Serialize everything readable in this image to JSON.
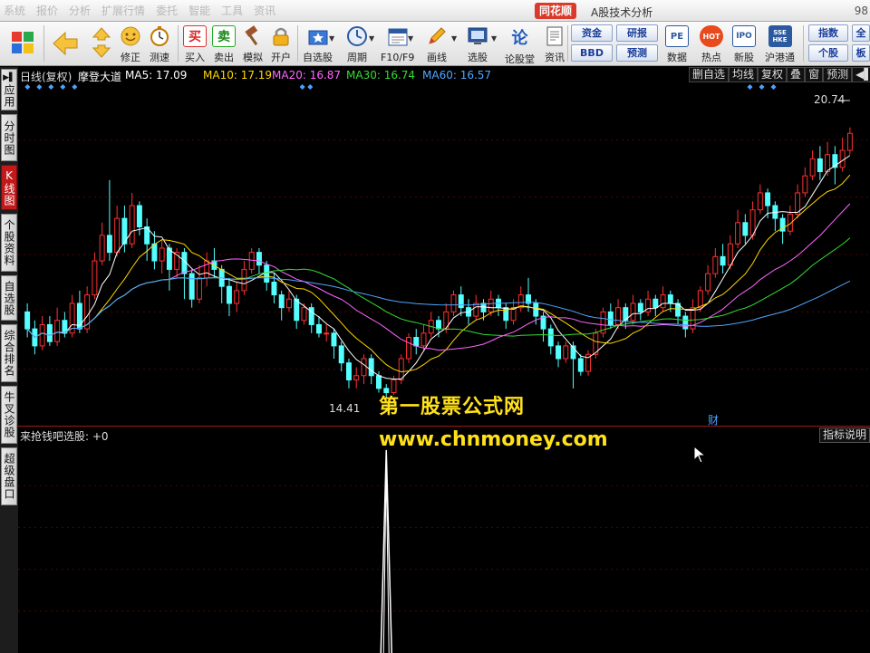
{
  "menu": {
    "items": [
      "系统",
      "报价",
      "分析",
      "扩展行情",
      "委托",
      "智能",
      "工具",
      "资讯"
    ],
    "brand": "同花顺",
    "window_title": "A股技术分析",
    "corner_text": "98"
  },
  "toolbar": {
    "buttons": [
      {
        "id": "repair",
        "label": "修正",
        "icon": "smile-icon"
      },
      {
        "id": "speed",
        "label": "测速",
        "icon": "stopwatch-icon"
      },
      {
        "id": "buy",
        "label": "买入",
        "icon": "buy-icon",
        "glyph": "买"
      },
      {
        "id": "sell",
        "label": "卖出",
        "icon": "sell-icon",
        "glyph": "卖"
      },
      {
        "id": "simulate",
        "label": "模拟",
        "icon": "hammer-icon"
      },
      {
        "id": "open-account",
        "label": "开户",
        "icon": "lock-icon"
      },
      {
        "id": "watchlist",
        "label": "自选股",
        "icon": "star-folder-icon"
      },
      {
        "id": "period",
        "label": "周期",
        "icon": "clock-icon"
      },
      {
        "id": "f10",
        "label": "F10/F9",
        "icon": "f10-icon"
      },
      {
        "id": "draw",
        "label": "画线",
        "icon": "pencil-icon"
      },
      {
        "id": "pick-stock",
        "label": "选股",
        "icon": "screen-icon"
      },
      {
        "id": "forum",
        "label": "论股堂",
        "icon": "forum-icon",
        "glyph": "论"
      },
      {
        "id": "news",
        "label": "资讯",
        "icon": "document-icon"
      },
      {
        "id": "data",
        "label": "数据",
        "icon": "pe-icon",
        "glyph": "PE"
      },
      {
        "id": "hot",
        "label": "热点",
        "icon": "hot-icon",
        "glyph": "HOT"
      },
      {
        "id": "new-stock",
        "label": "新股",
        "icon": "ipo-icon",
        "glyph": "IPO"
      },
      {
        "id": "hk-connect",
        "label": "沪港通",
        "icon": "sse-hke-icon",
        "glyph": "SSE HKE"
      }
    ],
    "small_buttons": {
      "fund": "资金",
      "research": "研报",
      "bbd": "BBD",
      "forecast": "预测",
      "index": "指数",
      "individual": "个股",
      "full": "全",
      "board": "板"
    }
  },
  "left_tabs": [
    {
      "label": "应用",
      "active": false,
      "icon": "play-icon"
    },
    {
      "label": "分时图",
      "active": false
    },
    {
      "label": "K线图",
      "active": true
    },
    {
      "label": "个股资料",
      "active": false
    },
    {
      "label": "自选股",
      "active": false
    },
    {
      "label": "综合排名",
      "active": false
    },
    {
      "label": "牛叉诊股",
      "active": false
    },
    {
      "label": "超级盘口",
      "active": false
    }
  ],
  "chart_header": {
    "period": "日线(复权)",
    "stock_name": "摩登大道",
    "ma5": "MA5: 17.09",
    "ma10": "MA10: 17.19",
    "ma20": "MA20: 16.87",
    "ma30": "MA30: 16.74",
    "ma60": "MA60: 16.57",
    "colors": {
      "ma5": "#ffffff",
      "ma10": "#ffd700",
      "ma20": "#ff66ff",
      "ma30": "#33dd33",
      "ma60": "#4fa6ff"
    }
  },
  "right_buttons": [
    "删自选",
    "均线",
    "复权",
    "叠",
    "窗",
    "预测"
  ],
  "price_labels": {
    "high": "20.74",
    "low": "14.41",
    "cai": "财"
  },
  "watermark": {
    "line1": "第一股票公式网",
    "line2": "www.chnmoney.com"
  },
  "indicator": {
    "header": "来抢钱吧选股: +0",
    "help_button": "指标说明"
  },
  "colors": {
    "up": "#ff3030",
    "down": "#54ffff",
    "grid": "#5a0000",
    "accent": "#c21a1a"
  },
  "chart_data": {
    "type": "candlestick",
    "series_name": "摩登大道 日线(复权)",
    "ylim": [
      14.0,
      21.5
    ],
    "high": 20.74,
    "low": 14.41,
    "candles": [
      [
        16.4,
        16.0,
        16.6,
        15.8
      ],
      [
        16.0,
        15.6,
        16.2,
        15.4
      ],
      [
        15.6,
        16.1,
        16.3,
        15.5
      ],
      [
        16.1,
        15.7,
        16.3,
        15.6
      ],
      [
        15.7,
        16.2,
        16.5,
        15.6
      ],
      [
        16.2,
        15.9,
        16.4,
        15.8
      ],
      [
        15.9,
        16.6,
        16.8,
        15.8
      ],
      [
        16.6,
        16.0,
        16.9,
        15.9
      ],
      [
        16.0,
        16.8,
        17.0,
        15.9
      ],
      [
        16.8,
        17.6,
        17.8,
        16.7
      ],
      [
        17.6,
        18.2,
        18.5,
        17.5
      ],
      [
        18.2,
        17.8,
        19.5,
        17.6
      ],
      [
        17.8,
        18.6,
        18.9,
        17.7
      ],
      [
        18.6,
        18.0,
        18.9,
        17.8
      ],
      [
        18.0,
        18.9,
        19.2,
        17.9
      ],
      [
        18.9,
        18.4,
        19.0,
        18.2
      ],
      [
        18.4,
        18.0,
        18.6,
        17.6
      ],
      [
        18.0,
        17.6,
        18.3,
        17.4
      ],
      [
        17.6,
        17.9,
        18.1,
        17.3
      ],
      [
        17.9,
        17.4,
        18.0,
        16.9
      ],
      [
        17.4,
        17.8,
        17.9,
        17.2
      ],
      [
        17.8,
        17.3,
        17.9,
        16.7
      ],
      [
        17.3,
        16.7,
        17.4,
        16.5
      ],
      [
        16.7,
        17.2,
        17.5,
        16.6
      ],
      [
        17.2,
        17.6,
        17.8,
        17.0
      ],
      [
        17.6,
        17.4,
        17.9,
        17.2
      ],
      [
        17.4,
        17.0,
        17.5,
        16.6
      ],
      [
        17.0,
        16.6,
        17.2,
        16.3
      ],
      [
        16.6,
        16.9,
        17.1,
        16.4
      ],
      [
        16.9,
        17.4,
        17.6,
        16.8
      ],
      [
        17.4,
        17.8,
        17.9,
        17.3
      ],
      [
        17.8,
        17.5,
        17.9,
        17.3
      ],
      [
        17.5,
        17.1,
        17.6,
        16.9
      ],
      [
        17.1,
        16.8,
        17.3,
        16.6
      ],
      [
        16.8,
        16.5,
        16.9,
        16.2
      ],
      [
        16.5,
        16.7,
        16.9,
        16.4
      ],
      [
        16.7,
        16.2,
        16.8,
        16.0
      ],
      [
        16.2,
        16.5,
        16.6,
        16.1
      ],
      [
        16.5,
        16.1,
        16.6,
        15.9
      ],
      [
        16.1,
        15.9,
        16.3,
        15.8
      ],
      [
        15.9,
        15.9,
        16.1,
        15.7
      ],
      [
        15.9,
        15.6,
        16.0,
        15.3
      ],
      [
        15.6,
        15.2,
        15.7,
        15.0
      ],
      [
        15.2,
        14.8,
        15.3,
        14.6
      ],
      [
        14.8,
        14.9,
        15.1,
        14.6
      ],
      [
        14.9,
        15.3,
        15.4,
        14.7
      ],
      [
        15.3,
        14.9,
        15.4,
        14.7
      ],
      [
        14.9,
        14.6,
        15.0,
        14.5
      ],
      [
        14.6,
        14.5,
        14.7,
        14.41
      ],
      [
        14.5,
        14.8,
        14.9,
        14.45
      ],
      [
        14.8,
        15.3,
        15.4,
        14.7
      ],
      [
        15.3,
        15.8,
        15.9,
        15.2
      ],
      [
        15.8,
        15.6,
        16.0,
        15.4
      ],
      [
        15.6,
        15.9,
        16.1,
        15.5
      ],
      [
        15.9,
        16.2,
        16.4,
        15.8
      ],
      [
        16.2,
        16.0,
        16.3,
        15.8
      ],
      [
        16.0,
        16.4,
        16.6,
        15.9
      ],
      [
        16.4,
        16.8,
        16.9,
        16.3
      ],
      [
        16.8,
        16.5,
        17.0,
        16.3
      ],
      [
        16.5,
        16.3,
        16.7,
        16.1
      ],
      [
        16.3,
        16.6,
        16.8,
        16.2
      ],
      [
        16.6,
        16.4,
        16.7,
        16.2
      ],
      [
        16.4,
        16.7,
        16.9,
        16.3
      ],
      [
        16.7,
        16.5,
        16.8,
        16.3
      ],
      [
        16.5,
        16.2,
        16.6,
        16.0
      ],
      [
        16.2,
        16.5,
        16.7,
        16.1
      ],
      [
        16.5,
        16.8,
        17.0,
        16.4
      ],
      [
        16.8,
        16.6,
        17.2,
        16.4
      ],
      [
        16.6,
        16.3,
        16.7,
        16.1
      ],
      [
        16.3,
        16.0,
        16.4,
        15.7
      ],
      [
        16.0,
        15.6,
        16.1,
        15.4
      ],
      [
        15.6,
        15.3,
        15.7,
        15.1
      ],
      [
        15.3,
        15.6,
        15.7,
        15.2
      ],
      [
        15.6,
        15.3,
        15.7,
        14.6
      ],
      [
        15.3,
        15.0,
        15.4,
        14.9
      ],
      [
        15.0,
        15.4,
        15.5,
        14.9
      ],
      [
        15.4,
        15.9,
        16.0,
        15.3
      ],
      [
        15.9,
        16.4,
        16.5,
        15.8
      ],
      [
        16.4,
        16.1,
        16.6,
        16.0
      ],
      [
        16.1,
        16.5,
        16.7,
        16.0
      ],
      [
        16.5,
        16.2,
        16.6,
        16.0
      ],
      [
        16.2,
        16.6,
        16.8,
        16.1
      ],
      [
        16.6,
        16.4,
        16.7,
        16.2
      ],
      [
        16.4,
        16.7,
        16.9,
        16.3
      ],
      [
        16.7,
        16.5,
        16.8,
        16.3
      ],
      [
        16.5,
        16.8,
        17.0,
        16.4
      ],
      [
        16.8,
        16.6,
        16.9,
        16.4
      ],
      [
        16.6,
        16.3,
        16.7,
        16.1
      ],
      [
        16.3,
        16.0,
        16.4,
        15.8
      ],
      [
        16.0,
        16.5,
        16.7,
        15.9
      ],
      [
        16.5,
        16.9,
        17.0,
        16.4
      ],
      [
        16.9,
        17.3,
        17.5,
        16.8
      ],
      [
        17.3,
        17.7,
        17.9,
        17.2
      ],
      [
        17.7,
        17.5,
        18.0,
        17.3
      ],
      [
        17.5,
        18.0,
        18.2,
        17.4
      ],
      [
        18.0,
        18.5,
        18.8,
        17.9
      ],
      [
        18.5,
        18.2,
        18.7,
        18.0
      ],
      [
        18.2,
        18.8,
        19.0,
        18.1
      ],
      [
        18.8,
        19.2,
        19.4,
        18.7
      ],
      [
        19.2,
        18.9,
        19.3,
        18.6
      ],
      [
        18.9,
        18.6,
        19.0,
        18.3
      ],
      [
        18.6,
        18.3,
        18.7,
        18.0
      ],
      [
        18.3,
        18.7,
        18.9,
        18.2
      ],
      [
        18.7,
        19.2,
        19.4,
        18.6
      ],
      [
        19.2,
        19.6,
        19.8,
        19.1
      ],
      [
        19.6,
        20.0,
        20.2,
        19.5
      ],
      [
        20.0,
        19.7,
        20.3,
        19.5
      ],
      [
        19.7,
        20.1,
        20.4,
        19.6
      ],
      [
        20.1,
        19.8,
        20.3,
        19.4
      ],
      [
        19.8,
        20.2,
        20.5,
        19.7
      ],
      [
        20.2,
        20.6,
        20.74,
        20.1
      ]
    ]
  },
  "indicator_data": {
    "type": "spike",
    "spike_index": 48,
    "spike_value": 1
  }
}
